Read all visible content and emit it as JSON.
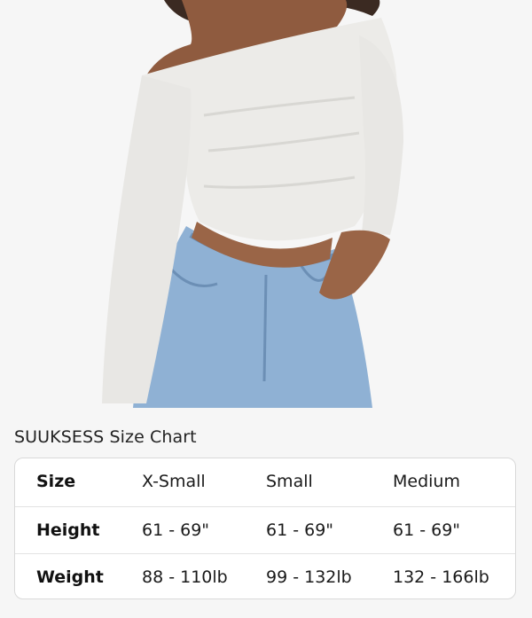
{
  "image": {
    "alt": "product-photo"
  },
  "size_chart": {
    "title": "SUUKSESS Size Chart",
    "header": {
      "label": "Size",
      "columns": [
        "X-Small",
        "Small",
        "Medium"
      ]
    },
    "rows": [
      {
        "label": "Height",
        "values": [
          "61 - 69\"",
          "61 - 69\"",
          "61 - 69\""
        ]
      },
      {
        "label": "Weight",
        "values": [
          "88 - 110lb",
          "99 - 132lb",
          "132 - 166lb"
        ]
      }
    ]
  }
}
